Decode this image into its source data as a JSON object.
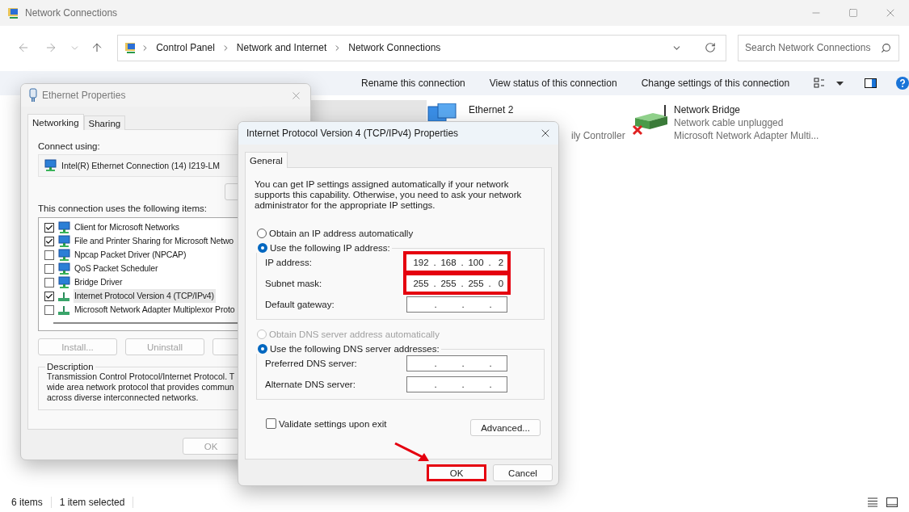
{
  "window": {
    "title": "Network Connections"
  },
  "address": {
    "crumbs": [
      "Control Panel",
      "Network and Internet",
      "Network Connections"
    ]
  },
  "search": {
    "placeholder": "Search Network Connections"
  },
  "commands": [
    {
      "label": "Rename this connection"
    },
    {
      "label": "View status of this connection"
    },
    {
      "label": "Change settings of this connection"
    }
  ],
  "connections": [
    {
      "kind": "hidden",
      "selected": true
    },
    {
      "kind": "ethernet",
      "selected": false,
      "name": "Ethernet 2",
      "lines": [
        {
          "text": "ily Controller",
          "clipped": true
        }
      ]
    },
    {
      "kind": "bridge",
      "selected": false,
      "name": "Network Bridge",
      "lines": [
        {
          "text": "Network cable unplugged",
          "clipped": false
        },
        {
          "text": "Microsoft Network Adapter Multi...",
          "clipped": false
        }
      ]
    }
  ],
  "status_bar": {
    "count": "6 items",
    "selection": "1 item selected"
  },
  "ethernet_properties": {
    "title": "Ethernet Properties",
    "tabs": [
      {
        "label": "Networking",
        "selected": true
      },
      {
        "label": "Sharing",
        "selected": false
      }
    ],
    "connect_using": "Connect using:",
    "adapter": "Intel(R) Ethernet Connection (14) I219-LM",
    "items_label": "This connection uses the following items:",
    "items": [
      {
        "label": "Client for Microsoft Networks",
        "kind": "client",
        "checked": true,
        "selected": false
      },
      {
        "label": "File and Printer Sharing for Microsoft Netwo",
        "kind": "client",
        "checked": true,
        "selected": false
      },
      {
        "label": "Npcap Packet Driver (NPCAP)",
        "kind": "client",
        "checked": false,
        "selected": false
      },
      {
        "label": "QoS Packet Scheduler",
        "kind": "client",
        "checked": false,
        "selected": false
      },
      {
        "label": "Bridge Driver",
        "kind": "client",
        "checked": false,
        "selected": false
      },
      {
        "label": "Internet Protocol Version 4 (TCP/IPv4)",
        "kind": "protocol",
        "checked": true,
        "selected": true
      },
      {
        "label": "Microsoft Network Adapter Multiplexor Proto",
        "kind": "protocol",
        "checked": false,
        "selected": false
      }
    ],
    "buttons": [
      {
        "label": "Install...",
        "disabled": true
      },
      {
        "label": "Uninstall",
        "disabled": true
      }
    ],
    "description": {
      "title": "Description",
      "lines": [
        "Transmission Control Protocol/Internet Protocol. T",
        "wide area network protocol that provides commun",
        "across diverse interconnected networks."
      ]
    },
    "ok": {
      "label": "OK",
      "disabled": true
    }
  },
  "ipv4": {
    "title": "Internet Protocol Version 4 (TCP/IPv4) Properties",
    "tabs": [
      {
        "label": "General",
        "selected": true
      }
    ],
    "intro": "You can get IP settings assigned automatically if your network supports this capability. Otherwise, you need to ask your network administrator for the appropriate IP settings.",
    "separator": ".",
    "ip_mode": [
      {
        "label": "Obtain an IP address automatically",
        "selected": false,
        "disabled": false
      },
      {
        "label": "Use the following IP address:",
        "selected": true,
        "disabled": false
      }
    ],
    "ip_fields": [
      {
        "label": "IP address:",
        "octets": [
          "192",
          "168",
          "100",
          "2"
        ],
        "highlighted": true
      },
      {
        "label": "Subnet mask:",
        "octets": [
          "255",
          "255",
          "255",
          "0"
        ],
        "highlighted": true
      },
      {
        "label": "Default gateway:",
        "highlighted": false
      }
    ],
    "dns_mode": [
      {
        "label": "Obtain DNS server address automatically",
        "selected": false,
        "disabled": true
      },
      {
        "label": "Use the following DNS server addresses:",
        "selected": true,
        "disabled": false
      }
    ],
    "dns_fields": [
      {
        "label": "Preferred DNS server:",
        "highlighted": false
      },
      {
        "label": "Alternate DNS server:",
        "highlighted": false
      }
    ],
    "validate": {
      "label": "Validate settings upon exit",
      "checked": false
    },
    "advanced": "Advanced...",
    "buttons": [
      {
        "label": "OK",
        "highlighted": true
      },
      {
        "label": "Cancel",
        "highlighted": false
      }
    ]
  }
}
